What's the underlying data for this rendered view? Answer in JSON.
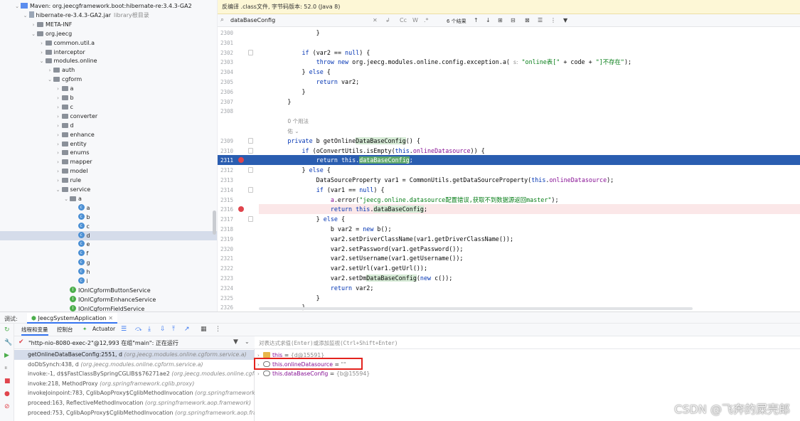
{
  "tree": {
    "items": [
      {
        "label": "Maven: org.jeecgframework.boot:hibernate-re:3.4.3-GA2",
        "sub": "",
        "icon": "maven-icon",
        "indent": 0,
        "expanded": true
      },
      {
        "label": "hibernate-re-3.4.3-GA2.jar",
        "sub": "library根目录",
        "icon": "jar-icon",
        "indent": 1,
        "expanded": true
      },
      {
        "label": "META-INF",
        "sub": "",
        "icon": "folder-icon",
        "indent": 2,
        "expanded": false
      },
      {
        "label": "org.jeecg",
        "sub": "",
        "icon": "folder-icon",
        "indent": 2,
        "expanded": true
      },
      {
        "label": "common.util.a",
        "sub": "",
        "icon": "folder-icon",
        "indent": 3,
        "expanded": false
      },
      {
        "label": "interceptor",
        "sub": "",
        "icon": "folder-icon",
        "indent": 3,
        "expanded": false
      },
      {
        "label": "modules.online",
        "sub": "",
        "icon": "folder-icon",
        "indent": 3,
        "expanded": true
      },
      {
        "label": "auth",
        "sub": "",
        "icon": "folder-icon",
        "indent": 4,
        "expanded": false
      },
      {
        "label": "cgform",
        "sub": "",
        "icon": "folder-icon",
        "indent": 4,
        "expanded": true
      },
      {
        "label": "a",
        "sub": "",
        "icon": "folder-icon",
        "indent": 5,
        "expanded": false
      },
      {
        "label": "b",
        "sub": "",
        "icon": "folder-icon",
        "indent": 5,
        "expanded": false
      },
      {
        "label": "c",
        "sub": "",
        "icon": "folder-icon",
        "indent": 5,
        "expanded": false
      },
      {
        "label": "converter",
        "sub": "",
        "icon": "folder-icon",
        "indent": 5,
        "expanded": false
      },
      {
        "label": "d",
        "sub": "",
        "icon": "folder-icon",
        "indent": 5,
        "expanded": false
      },
      {
        "label": "enhance",
        "sub": "",
        "icon": "folder-icon",
        "indent": 5,
        "expanded": false
      },
      {
        "label": "entity",
        "sub": "",
        "icon": "folder-icon",
        "indent": 5,
        "expanded": false
      },
      {
        "label": "enums",
        "sub": "",
        "icon": "folder-icon",
        "indent": 5,
        "expanded": false
      },
      {
        "label": "mapper",
        "sub": "",
        "icon": "folder-icon",
        "indent": 5,
        "expanded": false
      },
      {
        "label": "model",
        "sub": "",
        "icon": "folder-icon",
        "indent": 5,
        "expanded": false
      },
      {
        "label": "rule",
        "sub": "",
        "icon": "folder-icon",
        "indent": 5,
        "expanded": false
      },
      {
        "label": "service",
        "sub": "",
        "icon": "folder-icon",
        "indent": 5,
        "expanded": true
      },
      {
        "label": "a",
        "sub": "",
        "icon": "folder-icon",
        "indent": 6,
        "expanded": true
      },
      {
        "label": "a",
        "sub": "",
        "icon": "class-icon",
        "indent": 7,
        "expanded": null
      },
      {
        "label": "b",
        "sub": "",
        "icon": "class-icon",
        "indent": 7,
        "expanded": null
      },
      {
        "label": "c",
        "sub": "",
        "icon": "class-icon",
        "indent": 7,
        "expanded": null
      },
      {
        "label": "d",
        "sub": "",
        "icon": "class-icon",
        "indent": 7,
        "expanded": null,
        "selected": true
      },
      {
        "label": "e",
        "sub": "",
        "icon": "class-icon",
        "indent": 7,
        "expanded": null
      },
      {
        "label": "f",
        "sub": "",
        "icon": "class-icon",
        "indent": 7,
        "expanded": null
      },
      {
        "label": "g",
        "sub": "",
        "icon": "class-icon",
        "indent": 7,
        "expanded": null
      },
      {
        "label": "h",
        "sub": "",
        "icon": "class-icon",
        "indent": 7,
        "expanded": null
      },
      {
        "label": "i",
        "sub": "",
        "icon": "class-icon",
        "indent": 7,
        "expanded": null
      },
      {
        "label": "IOnlCgformButtonService",
        "sub": "",
        "icon": "interface-icon",
        "indent": 6,
        "expanded": null
      },
      {
        "label": "IOnlCgformEnhanceService",
        "sub": "",
        "icon": "interface-icon",
        "indent": 6,
        "expanded": null
      },
      {
        "label": "IOnlCgformFieldService",
        "sub": "",
        "icon": "interface-icon",
        "indent": 6,
        "expanded": null
      }
    ]
  },
  "editor": {
    "banner": "反编译 .class文件, 字节码版本: 52.0 (Java 8)",
    "search": {
      "value": "dataBaseConfig",
      "cc": "Cc",
      "w": "W",
      "regex": ".*",
      "results": "6 个结果"
    },
    "lines": [
      {
        "num": "2300",
        "html": "                }"
      },
      {
        "num": "2301",
        "html": ""
      },
      {
        "num": "2302",
        "html": "            <span class=\"kw\">if</span> (var2 == <span class=\"kw\">null</span>) {"
      },
      {
        "num": "2303",
        "html": "                <span class=\"kw\">throw new</span> org.jeecg.modules.online.config.exception.a( <span class=\"hint\">s:</span> <span class=\"st\">\"online表[\"</span> + code + <span class=\"st\">\"]不存在\"</span>);"
      },
      {
        "num": "2304",
        "html": "            } <span class=\"kw\">else</span> {"
      },
      {
        "num": "2305",
        "html": "                <span class=\"kw\">return</span> var2;"
      },
      {
        "num": "2306",
        "html": "            }"
      },
      {
        "num": "2307",
        "html": "        }"
      },
      {
        "num": "2308",
        "html": ""
      },
      {
        "num": "",
        "html": "        <span class=\"hint\">0 个用法</span>"
      },
      {
        "num": "",
        "html": "        <span class=\"hint\">佑 ⌄</span>"
      },
      {
        "num": "2309",
        "html": "        <span class=\"kw\">private</span> b getOnline<span class=\"hl\">DataBaseConfig</span>() {"
      },
      {
        "num": "2310",
        "html": "            <span class=\"kw\">if</span> (oConvertUtils.isEmpty(<span class=\"kw\">this</span>.<span class=\"fd\">onlineDatasource</span>)) {"
      },
      {
        "num": "2311",
        "html": "                <span class=\"kw\">return this</span>.<span class=\"hl\">dataBaseConfig</span>;",
        "cls": "cur",
        "bp": true
      },
      {
        "num": "2312",
        "html": "            } <span class=\"kw\">else</span> {"
      },
      {
        "num": "2313",
        "html": "                DataSourceProperty var1 = CommonUtils.getDataSourceProperty(<span class=\"kw\">this</span>.<span class=\"fd\">onlineDatasource</span>);"
      },
      {
        "num": "2314",
        "html": "                <span class=\"kw\">if</span> (var1 == <span class=\"kw\">null</span>) {"
      },
      {
        "num": "2315",
        "html": "                    <span class=\"fd\">a</span>.error(<span class=\"st\">\"jeecg.online.datasource配置错误,获取不到数据源返回master\"</span>);"
      },
      {
        "num": "2316",
        "html": "                    <span class=\"kw\">return this</span>.<span class=\"hl\">dataBaseConfig</span>;",
        "cls": "bpl",
        "bp": true
      },
      {
        "num": "2317",
        "html": "                } <span class=\"kw\">else</span> {"
      },
      {
        "num": "2318",
        "html": "                    b var2 = <span class=\"kw\">new</span> b();"
      },
      {
        "num": "2319",
        "html": "                    var2.setDriverClassName(var1.getDriverClassName());"
      },
      {
        "num": "2320",
        "html": "                    var2.setPassword(var1.getPassword());"
      },
      {
        "num": "2321",
        "html": "                    var2.setUsername(var1.getUsername());"
      },
      {
        "num": "2322",
        "html": "                    var2.setUrl(var1.getUrl());"
      },
      {
        "num": "2323",
        "html": "                    var2.setDm<span class=\"hl\">DataBaseConfig</span>(<span class=\"kw\">new</span> c());"
      },
      {
        "num": "2324",
        "html": "                    <span class=\"kw\">return</span> var2;"
      },
      {
        "num": "2325",
        "html": "                }"
      },
      {
        "num": "2326",
        "html": "            }"
      }
    ]
  },
  "debug": {
    "label": "调试:",
    "config": "JeecgSystemApplication",
    "tabs": {
      "threads": "线程和变量",
      "console": "控制台",
      "actuator": "Actuator"
    },
    "thread": "\"http-nio-8080-exec-2\"@12,993 在组\"main\": 正在运行",
    "frames": [
      {
        "method": "getOnlineDataBaseConfig:2551, d",
        "cls": "(org.jeecg.modules.online.cgform.service.a)",
        "selected": true
      },
      {
        "method": "doDbSynch:438, d",
        "cls": "(org.jeecg.modules.online.cgform.service.a)"
      },
      {
        "method": "invoke:-1, d$$FastClassBySpringCGLIB$$76271ae2",
        "cls": "(org.jeecg.modules.online.cgform.se"
      },
      {
        "method": "invoke:218, MethodProxy",
        "cls": "(org.springframework.cglib.proxy)"
      },
      {
        "method": "invokeJoinpoint:783, CglibAopProxy$CglibMethodInvocation",
        "cls": "(org.springframework.ao"
      },
      {
        "method": "proceed:163, ReflectiveMethodInvocation",
        "cls": "(org.springframework.aop.framework)"
      },
      {
        "method": "proceed:753, CglibAopProxy$CglibMethodInvocation",
        "cls": "(org.springframework.aop.frame"
      }
    ],
    "eval_placeholder": "对表达式求值(Enter)或添加监视(Ctrl+Shift+Enter)",
    "vars": [
      {
        "name": "this",
        "eq": " = ",
        "value": "{d@15591}"
      },
      {
        "name": "this.onlineDatasource",
        "eq": " = ",
        "value": "\"\""
      },
      {
        "name": "this.dataBaseConfig",
        "eq": " = ",
        "value": "{b@15594}"
      }
    ]
  },
  "watermark": "CSDN @飞奔的屎壳郎"
}
